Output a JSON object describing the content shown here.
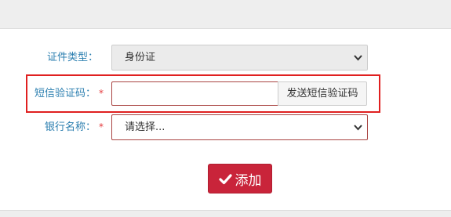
{
  "form": {
    "id_type": {
      "label": "证件类型：",
      "value": "身份证",
      "required": false
    },
    "sms_code": {
      "label": "短信验证码：",
      "required_mark": "*",
      "value": "",
      "send_button": "发送短信验证码"
    },
    "bank_name": {
      "label": "银行名称：",
      "required_mark": "*",
      "value": "请选择..."
    },
    "submit_label": "添加"
  },
  "colors": {
    "label": "#2c7fb0",
    "required": "#e4393c",
    "error_border": "#a94442",
    "highlight": "#e02020",
    "primary_button": "#c9243a"
  },
  "icons": {
    "select_arrow": "chevron-down-icon",
    "submit": "checkmark-icon"
  }
}
